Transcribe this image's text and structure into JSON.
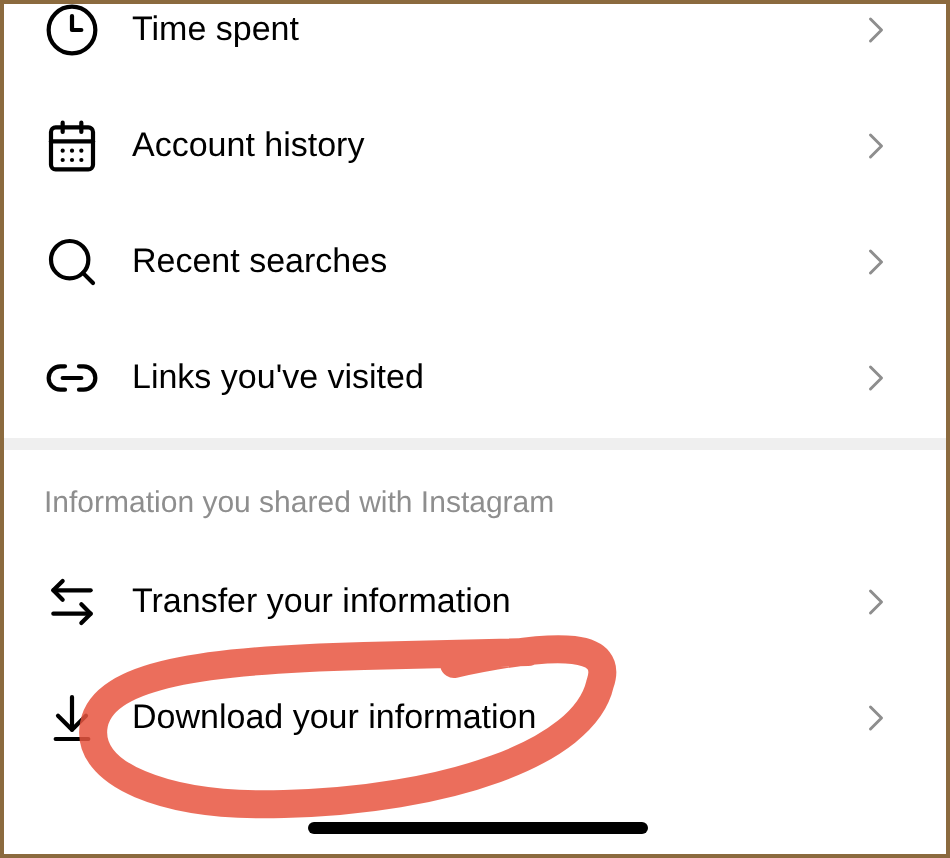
{
  "sections": [
    {
      "items": [
        {
          "label": "Time spent"
        },
        {
          "label": "Account history"
        },
        {
          "label": "Recent searches"
        },
        {
          "label": "Links you've visited"
        }
      ]
    },
    {
      "header": "Information you shared with Instagram",
      "items": [
        {
          "label": "Transfer your information"
        },
        {
          "label": "Download your information"
        }
      ]
    }
  ]
}
